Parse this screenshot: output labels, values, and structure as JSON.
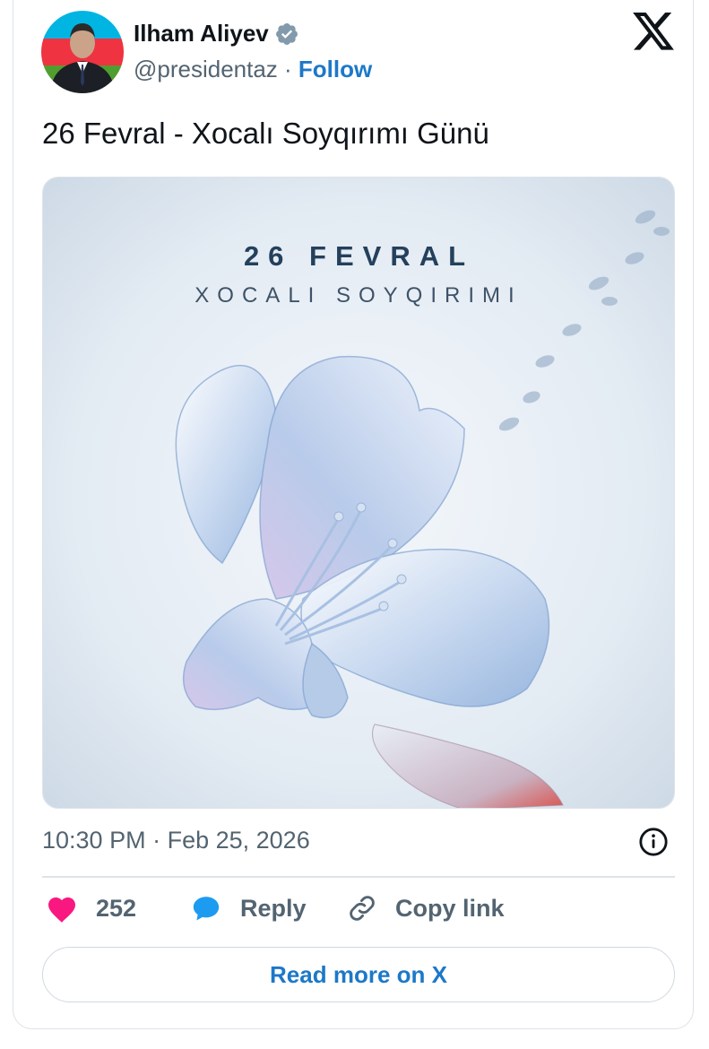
{
  "author": {
    "name": "Ilham Aliyev",
    "handle": "@presidentaz",
    "separator": " · ",
    "follow_label": "Follow",
    "verified_icon": "verified-badge-icon",
    "avatar_colors": {
      "flag_blue": "#00b5e2",
      "flag_red": "#ef3340",
      "flag_green": "#509e2f"
    }
  },
  "brand_icon": "x-logo-icon",
  "tweet": {
    "text": "26 Fevral - Xocalı Soyqırımı Günü"
  },
  "media": {
    "title": "26 FEVRAL",
    "subtitle": "XOCALI SOYQIRIMI",
    "description_icon": "glass-flower-illustration"
  },
  "meta": {
    "time": "10:30 PM",
    "separator": " · ",
    "date": "Feb 25, 2026",
    "info_icon": "info-icon"
  },
  "actions": {
    "like_count": "252",
    "reply_label": "Reply",
    "copy_link_label": "Copy link"
  },
  "read_more_label": "Read more on X",
  "colors": {
    "accent": "#1d78c8",
    "like": "#f91880",
    "reply_icon": "#1d9bf0",
    "muted_text": "#536471",
    "border": "#dde3e8"
  }
}
